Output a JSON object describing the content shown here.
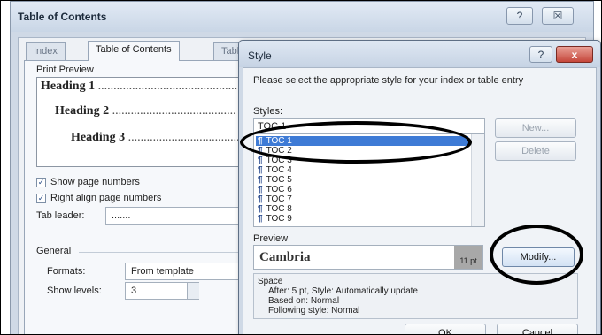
{
  "toc_dialog": {
    "title": "Table of Contents",
    "help_glyph": "?",
    "close_glyph": "☒",
    "tabs": [
      {
        "label": "Index",
        "active": false
      },
      {
        "label": "Table of Contents",
        "active": true
      },
      {
        "label": "Table",
        "active": false
      }
    ],
    "print_preview_label": "Print Preview",
    "preview_lines": [
      {
        "text": "Heading 1",
        "dots": "..............................................."
      },
      {
        "text": "Heading 2",
        "dots": "........................................"
      },
      {
        "text": "Heading 3",
        "dots": "...................................."
      }
    ],
    "show_page_numbers": {
      "label": "Show page numbers",
      "checked": true
    },
    "right_align": {
      "label": "Right align page numbers",
      "checked": true
    },
    "tab_leader": {
      "label": "Tab leader:",
      "value": "......."
    },
    "general": {
      "label": "General",
      "formats_label": "Formats:",
      "formats_value": "From template",
      "show_levels_label": "Show levels:",
      "show_levels_value": "3"
    }
  },
  "style_dialog": {
    "title": "Style",
    "help_glyph": "?",
    "close_glyph": "x",
    "instruction": "Please select the appropriate style for your index or table entry",
    "styles_label": "Styles:",
    "styles_input_value": "TOC 1",
    "para_glyph": "¶",
    "styles_list": [
      "TOC 1",
      "TOC 2",
      "TOC 3",
      "TOC 4",
      "TOC 5",
      "TOC 6",
      "TOC 7",
      "TOC 8",
      "TOC 9"
    ],
    "selected_style": "TOC 1",
    "new_button": "New...",
    "delete_button": "Delete",
    "preview_label": "Preview",
    "preview_font": "Cambria",
    "preview_size": "11 pt",
    "modify_button": "Modify...",
    "description": [
      "Space",
      "After:  5 pt, Style: Automatically update",
      "Based on: Normal",
      "Following style: Normal"
    ],
    "ok_button": "OK",
    "cancel_button": "Cancel"
  },
  "colors": {
    "selection": "#3e7bd6",
    "close_button": "#c5463a",
    "annotation": "#000000"
  }
}
